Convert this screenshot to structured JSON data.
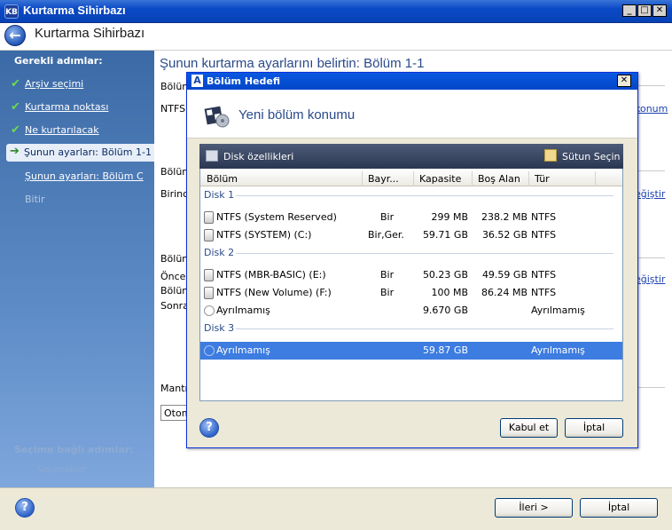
{
  "window": {
    "title": "Kurtarma Sihirbazı",
    "app_icon_text": "KB",
    "controls": {
      "minimize": "_",
      "maximize": "□",
      "close": "✕"
    }
  },
  "header": {
    "title": "Kurtarma Sihirbazı",
    "back_icon": "back-arrow-icon"
  },
  "sidebar": {
    "heading": "Gerekli adımlar:",
    "steps": [
      {
        "label": "Arşiv seçimi",
        "state": "done"
      },
      {
        "label": "Kurtarma noktası",
        "state": "done"
      },
      {
        "label": "Ne kurtarılacak",
        "state": "done"
      },
      {
        "label": "Şunun ayarları: Bölüm 1-1",
        "state": "current"
      },
      {
        "label": "Şunun ayarları: Bölüm C",
        "state": "link"
      },
      {
        "label": "Bitir",
        "state": "disabled"
      }
    ],
    "optional_heading": "Seçime bağlı adımlar:",
    "optional_item": "Seçenekler"
  },
  "content": {
    "title": "Şunun kurtarma ayarlarını belirtin: Bölüm 1-1",
    "partial_labels": [
      "Bölüm",
      "NTFS",
      "Bölüm",
      "Birincil",
      "Bölüm",
      "Önces",
      "Bölüm",
      "Sonra",
      "Mantık"
    ],
    "links": [
      "konum",
      "eğiştir",
      "eğiştir"
    ],
    "otom_value": "Otom"
  },
  "bottom": {
    "next_label": "İleri >",
    "cancel_label": "İptal"
  },
  "dialog": {
    "title": "Bölüm Hedefi",
    "heading": "Yeni bölüm konumu",
    "toolbar": {
      "disk_props": "Disk özellikleri",
      "choose_cols": "Sütun Seçin"
    },
    "columns": [
      "Bölüm",
      "Bayr...",
      "Kapasite",
      "Boş Alan",
      "Tür"
    ],
    "groups": [
      {
        "name": "Disk 1",
        "rows": [
          {
            "name": "NTFS (System Reserved)",
            "flags": "Bir",
            "capacity": "299 MB",
            "free": "238.2 MB",
            "type": "NTFS",
            "kind": "disk"
          },
          {
            "name": "NTFS (SYSTEM) (C:)",
            "flags": "Bir,Ger.",
            "capacity": "59.71 GB",
            "free": "36.52 GB",
            "type": "NTFS",
            "kind": "disk"
          }
        ]
      },
      {
        "name": "Disk 2",
        "rows": [
          {
            "name": "NTFS (MBR-BASIC) (E:)",
            "flags": "Bir",
            "capacity": "50.23 GB",
            "free": "49.59 GB",
            "type": "NTFS",
            "kind": "disk"
          },
          {
            "name": "NTFS (New Volume) (F:)",
            "flags": "Bir",
            "capacity": "100 MB",
            "free": "86.24 MB",
            "type": "NTFS",
            "kind": "disk"
          },
          {
            "name": "Ayrılmamış",
            "flags": "",
            "capacity": "9.670 GB",
            "free": "",
            "type": "Ayrılmamış",
            "kind": "unalloc"
          }
        ]
      },
      {
        "name": "Disk 3",
        "rows": [
          {
            "name": "Ayrılmamış",
            "flags": "",
            "capacity": "59.87 GB",
            "free": "",
            "type": "Ayrılmamış",
            "kind": "unalloc",
            "selected": true
          }
        ]
      }
    ],
    "ok_label": "Kabul et",
    "cancel_label": "İptal",
    "close": "✕"
  },
  "help_glyph": "?",
  "colors": {
    "titlebar": "#0a49c6",
    "sidebar": "#3b6aa6",
    "selection": "#3d7ce0"
  }
}
